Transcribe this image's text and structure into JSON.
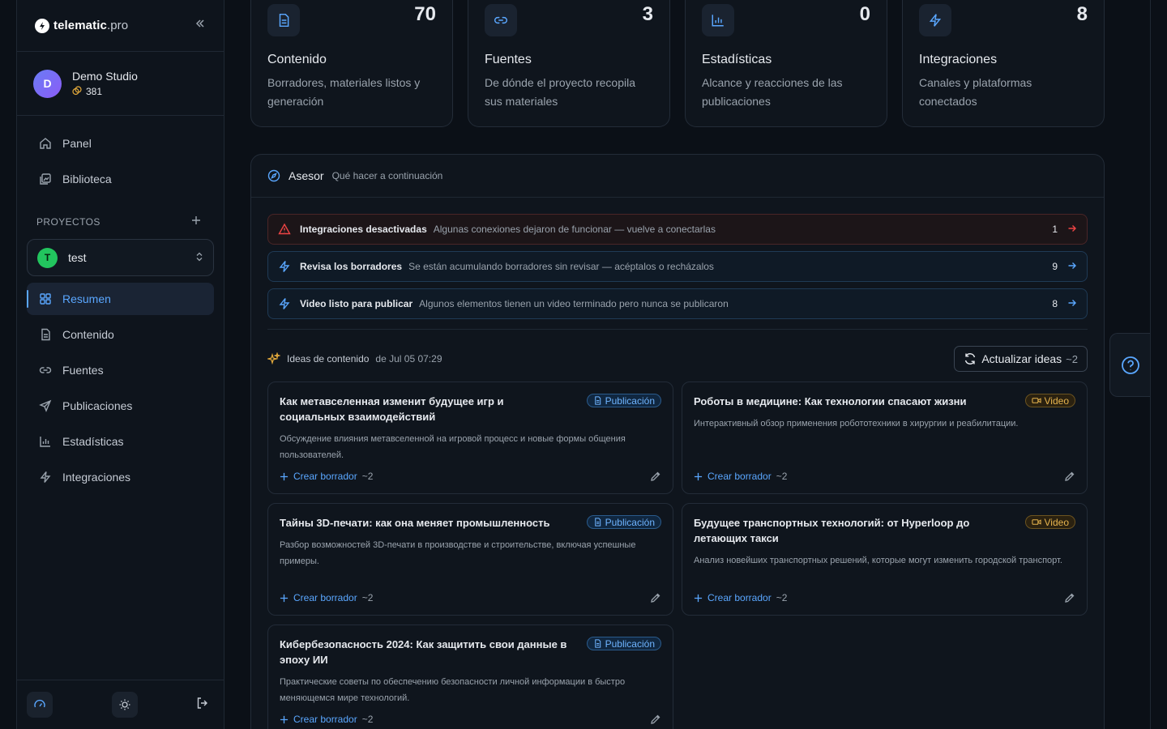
{
  "brand": {
    "name_bold": "telematic",
    "name_thin": ".pro"
  },
  "account": {
    "initial": "D",
    "name": "Demo Studio",
    "credits": "381"
  },
  "nav_top": [
    {
      "label": "Panel",
      "icon": "home-icon"
    },
    {
      "label": "Biblioteca",
      "icon": "library-icon"
    }
  ],
  "projects": {
    "label": "PROYECTOS",
    "current_initial": "T",
    "current_name": "test"
  },
  "nav_project": [
    {
      "label": "Resumen",
      "icon": "grid-icon",
      "active": true
    },
    {
      "label": "Contenido",
      "icon": "file-icon"
    },
    {
      "label": "Fuentes",
      "icon": "link-icon"
    },
    {
      "label": "Publicaciones",
      "icon": "send-icon"
    },
    {
      "label": "Estadísticas",
      "icon": "bar-chart-icon"
    },
    {
      "label": "Integraciones",
      "icon": "bolt-icon"
    }
  ],
  "stats": [
    {
      "value": "70",
      "title": "Contenido",
      "desc": "Borradores, materiales listos y generación",
      "icon": "file-icon"
    },
    {
      "value": "3",
      "title": "Fuentes",
      "desc": "De dónde el proyecto recopila sus materiales",
      "icon": "link-icon"
    },
    {
      "value": "0",
      "title": "Estadísticas",
      "desc": "Alcance y reacciones de las publicaciones",
      "icon": "bar-chart-icon"
    },
    {
      "value": "8",
      "title": "Integraciones",
      "desc": "Canales y plataformas conectados",
      "icon": "bolt-icon"
    }
  ],
  "advisor": {
    "title": "Asesor",
    "subtitle": "Qué hacer a continuación",
    "alerts": [
      {
        "title": "Integraciones desactivadas",
        "desc": "Algunas conexiones dejaron de funcionar — vuelve a conectarlas",
        "count": "1",
        "tone": "danger"
      },
      {
        "title": "Revisa los borradores",
        "desc": "Se están acumulando borradores sin revisar — acéptalos o recházalos",
        "count": "9",
        "tone": "info"
      },
      {
        "title": "Video listo para publicar",
        "desc": "Algunos elementos tienen un video terminado pero nunca se publicaron",
        "count": "8",
        "tone": "info"
      }
    ]
  },
  "ideas": {
    "label": "Ideas de contenido",
    "date": "de Jul 05 07:29",
    "refresh_label": "Actualizar ideas",
    "refresh_cost": "~2",
    "create_label": "Crear borrador",
    "create_cost": "~2",
    "items": [
      {
        "title": "Как метавселенная изменит будущее игр и социальных взаимодействий",
        "badge": "Publicación",
        "kind": "pub",
        "desc": "Обсуждение влияния метавселенной на игровой процесс и новые формы общения пользователей."
      },
      {
        "title": "Роботы в медицине: Как технологии спасают жизни",
        "badge": "Video",
        "kind": "vid",
        "desc": "Интерактивный обзор применения робототехники в хирургии и реабилитации."
      },
      {
        "title": "Тайны 3D-печати: как она меняет промышленность",
        "badge": "Publicación",
        "kind": "pub",
        "desc": "Разбор возможностей 3D-печати в производстве и строительстве, включая успешные примеры."
      },
      {
        "title": "Будущее транспортных технологий: от Hyperloop до летающих такси",
        "badge": "Video",
        "kind": "vid",
        "desc": "Анализ новейших транспортных решений, которые могут изменить городской транспорт."
      },
      {
        "title": "Кибербезопасность 2024: Как защитить свои данные в эпоху ИИ",
        "badge": "Publicación",
        "kind": "pub",
        "desc": "Практические советы по обеспечению безопасности личной информации в быстро меняющемся мире технологий."
      }
    ]
  }
}
